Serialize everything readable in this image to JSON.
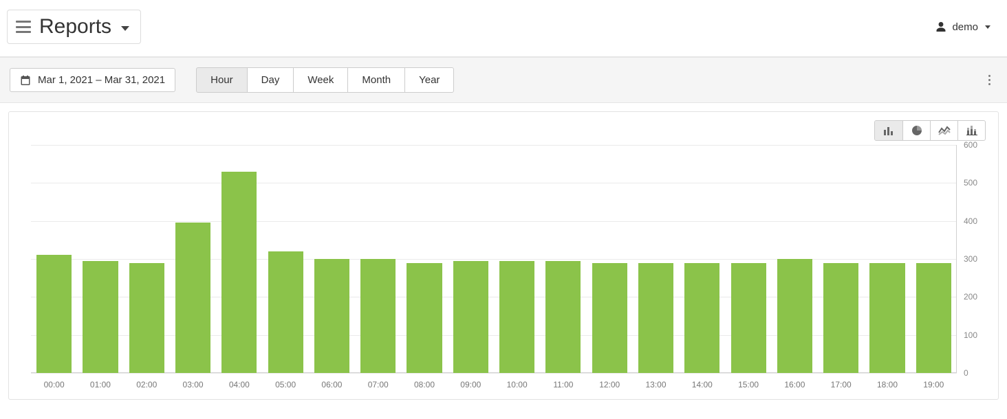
{
  "header": {
    "title": "Reports",
    "user_label": "demo"
  },
  "toolbar": {
    "date_range_label": "Mar 1, 2021 – Mar 31, 2021",
    "granularity": {
      "options": [
        "Hour",
        "Day",
        "Week",
        "Month",
        "Year"
      ],
      "active_index": 0
    }
  },
  "chart_types": {
    "items": [
      {
        "name": "bar-chart-icon"
      },
      {
        "name": "pie-chart-icon"
      },
      {
        "name": "line-chart-icon"
      },
      {
        "name": "stacked-bar-icon"
      }
    ],
    "active_index": 0
  },
  "chart_data": {
    "type": "bar",
    "title": "",
    "xlabel": "",
    "ylabel": "",
    "ylim": [
      0,
      600
    ],
    "yticks": [
      0,
      100,
      200,
      300,
      400,
      500,
      600
    ],
    "categories": [
      "00:00",
      "01:00",
      "02:00",
      "03:00",
      "04:00",
      "05:00",
      "06:00",
      "07:00",
      "08:00",
      "09:00",
      "10:00",
      "11:00",
      "12:00",
      "13:00",
      "14:00",
      "15:00",
      "16:00",
      "17:00",
      "18:00",
      "19:00"
    ],
    "values": [
      310,
      295,
      290,
      395,
      530,
      320,
      300,
      300,
      290,
      295,
      295,
      295,
      290,
      290,
      290,
      290,
      300,
      290,
      290,
      290
    ],
    "bar_color": "#8bc34a"
  }
}
